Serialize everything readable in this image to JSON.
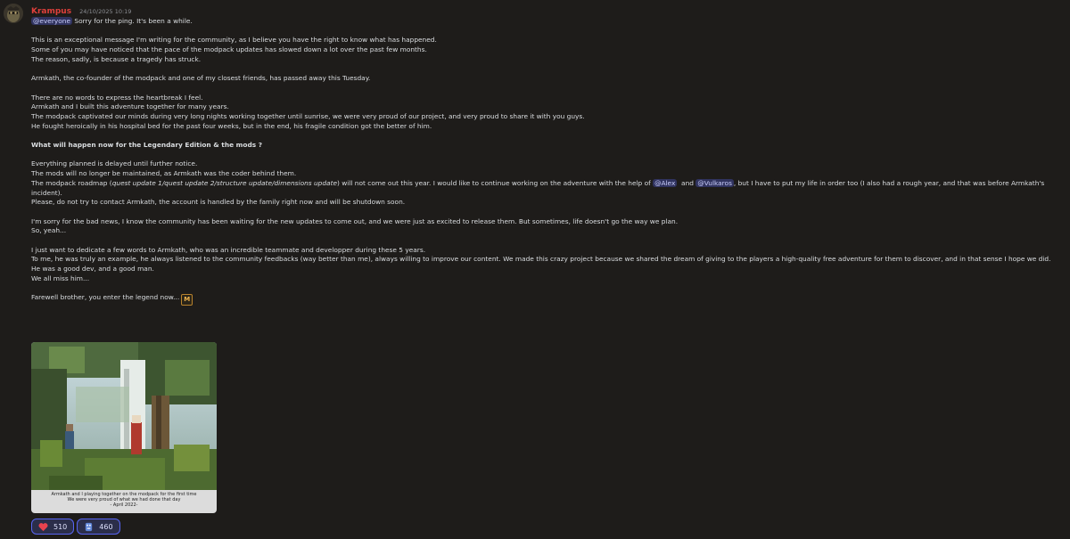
{
  "message": {
    "author": "Krampus",
    "timestamp": "24/10/2025 10:19",
    "mention_everyone": "@everyone",
    "intro": " Sorry for the ping. It's been a while.",
    "p1": [
      "This is an exceptional message I'm writing for the community, as I believe you have the right to know what has happened.",
      "Some of you may have noticed that the pace of the modpack updates has slowed down a lot over the past few months.",
      "The reason, sadly, is because a tragedy has struck."
    ],
    "p2": "Armkath, the co-founder of the modpack and one of my closest friends, has passed away this Tuesday.",
    "p3": [
      "There are no words to express the heartbreak I feel.",
      "Armkath and I built this adventure together for many years.",
      "The modpack captivated our minds during very long nights working together until sunrise, we were very proud of our project, and very proud to share it with you guys.",
      "He fought heroically in his hospital bed for the past four weeks, but in the end, his fragile condition got the better of him."
    ],
    "heading": "What will happen now for the Legendary Edition & the mods ?",
    "p4_lines": [
      "Everything planned is delayed until further notice.",
      "The mods will no longer be maintained, as Armkath was the coder behind them."
    ],
    "roadmap": {
      "pre": "The modpack roadmap (",
      "italic": "quest update 1/quest update 2/structure update/dimensions update",
      "mid": ") will not come out this year. I would like to continue working on the adventure with the help of ",
      "mention1": "@Alex",
      "and": "  and ",
      "mention2": "@Vulkaros",
      "post": ", but I have to put my life in order too (I also had a rough year, and that was before Armkath's incident)."
    },
    "p4_last": "Please, do not try to contact Armkath, the account is handled by the family right now and will be shutdown soon.",
    "p5": [
      "I'm sorry for the bad news, I know the community has been waiting for the new updates to come out, and we were just as excited to release them. But sometimes, life doesn't go the way we plan.",
      "So, yeah..."
    ],
    "p6": [
      "I just want to dedicate a few words to Armkath, who was an incredible teammate and developper during these 5 years.",
      "To me, he was truly an example, he always listened to the community feedbacks (way better than me), always willing to improve our content. We made this crazy project because we shared the dream of giving to the players a high-quality free adventure for them to discover, and in that sense I hope we did.",
      "He was a good dev, and a good man.",
      "We all miss him..."
    ],
    "farewell": "Farewell brother, you enter the legend now...",
    "farewell_emoji_icon": "modpack-m-emoji"
  },
  "attachment": {
    "caption": [
      "Armkath and I playing together on the modpack for the first time",
      "We were very proud of what we had done that day",
      "- April 2022-"
    ]
  },
  "reactions": [
    {
      "icon": "heart-icon",
      "count": "510",
      "color": "#e8434f"
    },
    {
      "icon": "salute-emoji-icon",
      "count": "460",
      "color": "#5f86d8"
    }
  ],
  "colors": {
    "background": "#1e1c1a",
    "author": "#e0403b",
    "mention_bg": "#3b3f70",
    "reaction_border": "#5865f2"
  }
}
